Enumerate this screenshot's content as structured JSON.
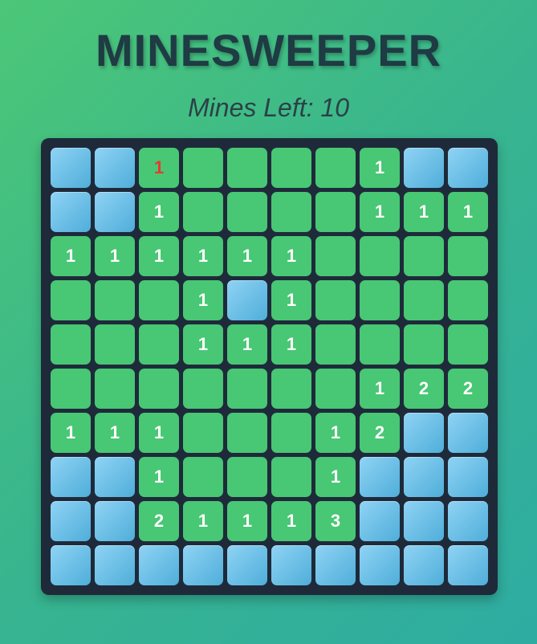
{
  "title": "MINESWEEPER",
  "status": {
    "label": "Mines Left: 10",
    "mines_left": 10
  },
  "colors": {
    "hidden_cell": "#6cc1ea",
    "revealed_cell": "#48c774",
    "board": "#1e2a3a",
    "number": "#ffffff",
    "highlight_number": "#e53935"
  },
  "board": {
    "rows": 10,
    "cols": 10,
    "legend": "H = hidden, E = revealed empty, digit = revealed number",
    "grid": [
      [
        "H",
        "H",
        "1",
        "E",
        "E",
        "E",
        "E",
        "1",
        "H",
        "H"
      ],
      [
        "H",
        "H",
        "1",
        "E",
        "E",
        "E",
        "E",
        "1",
        "1",
        "1"
      ],
      [
        "1",
        "1",
        "1",
        "1",
        "1",
        "1",
        "E",
        "E",
        "E",
        "E"
      ],
      [
        "E",
        "E",
        "E",
        "1",
        "H",
        "1",
        "E",
        "E",
        "E",
        "E"
      ],
      [
        "E",
        "E",
        "E",
        "1",
        "1",
        "1",
        "E",
        "E",
        "E",
        "E"
      ],
      [
        "E",
        "E",
        "E",
        "E",
        "E",
        "E",
        "E",
        "1",
        "2",
        "2"
      ],
      [
        "1",
        "1",
        "1",
        "E",
        "E",
        "E",
        "1",
        "2",
        "H",
        "H"
      ],
      [
        "H",
        "H",
        "1",
        "E",
        "E",
        "E",
        "1",
        "H",
        "H",
        "H"
      ],
      [
        "H",
        "H",
        "2",
        "1",
        "1",
        "1",
        "3",
        "H",
        "H",
        "H"
      ],
      [
        "H",
        "H",
        "H",
        "H",
        "H",
        "H",
        "H",
        "H",
        "H",
        "H"
      ]
    ],
    "red_number_cells": [
      [
        0,
        2
      ]
    ]
  }
}
